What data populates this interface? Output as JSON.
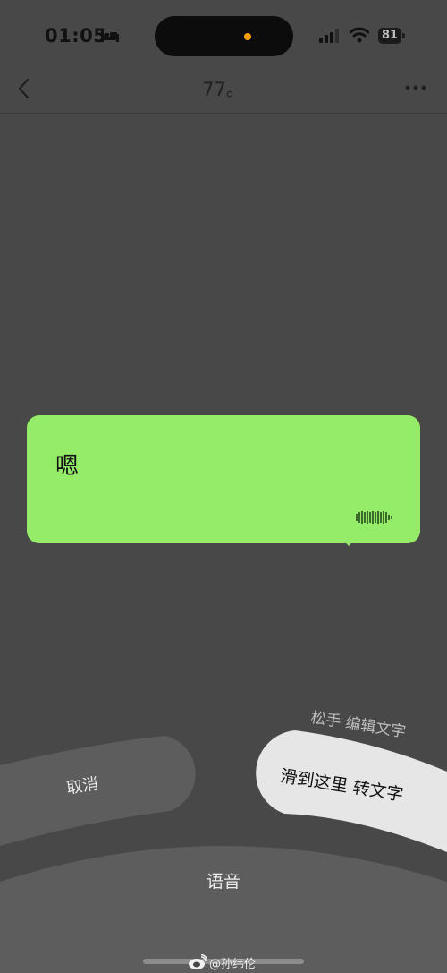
{
  "status_bar": {
    "time": "01:05",
    "battery": "81"
  },
  "nav": {
    "title": "77。"
  },
  "bubble": {
    "text": "嗯"
  },
  "hint": {
    "text": "松手 编辑文字"
  },
  "buttons": {
    "cancel": "取消",
    "convert": "滑到这里 转文字",
    "voice": "语音"
  },
  "watermark": {
    "text": "@孙纬伦"
  },
  "colors": {
    "bubble": "#95ec69",
    "background": "#484848",
    "convert_button": "#e6e6e6",
    "dynamic_island_dot": "#ff9f0a"
  }
}
